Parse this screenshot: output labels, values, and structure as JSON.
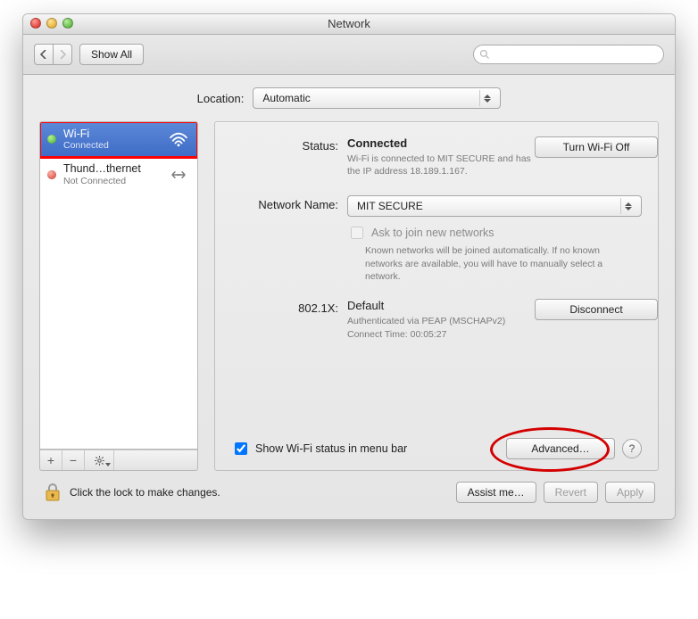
{
  "window": {
    "title": "Network"
  },
  "toolbar": {
    "show_all": "Show All",
    "search_placeholder": ""
  },
  "location": {
    "label": "Location:",
    "value": "Automatic"
  },
  "sidebar": {
    "services": [
      {
        "name": "Wi-Fi",
        "status": "Connected",
        "dot": "green",
        "selected": true
      },
      {
        "name": "Thund…thernet",
        "status": "Not Connected",
        "dot": "red",
        "selected": false
      }
    ]
  },
  "detail": {
    "status_label": "Status:",
    "status_value": "Connected",
    "wifi_toggle": "Turn Wi-Fi Off",
    "status_desc": "Wi-Fi is connected to MIT SECURE and has the IP address 18.189.1.167.",
    "network_label": "Network Name:",
    "network_value": "MIT SECURE",
    "ask_join": "Ask to join new networks",
    "ask_join_desc": "Known networks will be joined automatically. If no known networks are available, you will have to manually select a network.",
    "dot1x_label": "802.1X:",
    "dot1x_value": "Default",
    "disconnect": "Disconnect",
    "dot1x_desc1": "Authenticated via PEAP (MSCHAPv2)",
    "dot1x_desc2": "Connect Time: 00:05:27",
    "show_status": "Show Wi-Fi status in menu bar",
    "advanced": "Advanced…",
    "help": "?"
  },
  "footer": {
    "lock_text": "Click the lock to make changes.",
    "assist": "Assist me…",
    "revert": "Revert",
    "apply": "Apply"
  }
}
